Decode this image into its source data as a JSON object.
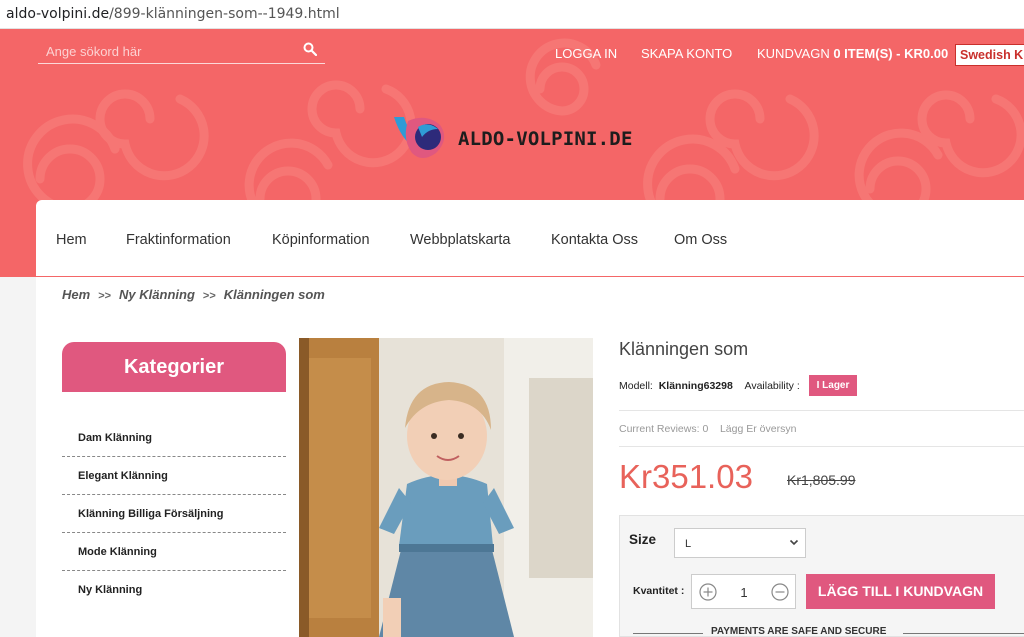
{
  "browser": {
    "url_host": "aldo-volpini.de",
    "url_path": "/899-klänningen-som--1949.html"
  },
  "topbar": {
    "search_placeholder": "Ange sökord här",
    "login": "LOGGA IN",
    "register": "SKAPA KONTO",
    "cart_prefix": "KUNDVAGN",
    "cart_summary": "0 ITEM(S) - KR0.00",
    "language": "Swedish Kr"
  },
  "brand": {
    "logo_text": "ALDO-VOLPINI.DE",
    "colors": {
      "primary": "#f46667",
      "accent": "#e0587f",
      "price": "#e8625a"
    }
  },
  "nav": {
    "items": [
      "Hem",
      "Fraktinformation",
      "Köpinformation",
      "Webbplatskarta",
      "Kontakta Oss",
      "Om Oss"
    ]
  },
  "breadcrumb": {
    "items": [
      "Hem",
      "Ny Klänning",
      "Klänningen som"
    ],
    "separator": ">>"
  },
  "sidebar": {
    "title": "Kategorier",
    "categories": [
      "Dam Klänning",
      "Elegant Klänning",
      "Klänning Billiga Försäljning",
      "Mode Klänning",
      "Ny Klänning"
    ]
  },
  "product": {
    "title": "Klänningen som",
    "model_label": "Modell:",
    "model": "Klänning63298",
    "availability_label": "Availability :",
    "availability": "I Lager",
    "reviews": "Current Reviews: 0",
    "write_review": "Lägg Er översyn",
    "price": "Kr351.03",
    "old_price": "Kr1,805.99",
    "size_label": "Size",
    "size_value": "L",
    "qty_label": "Kvantitet :",
    "qty_value": "1",
    "add_to_cart": "LÄGG TILL I KUNDVAGN",
    "secure_text": "PAYMENTS ARE SAFE AND SECURE"
  }
}
